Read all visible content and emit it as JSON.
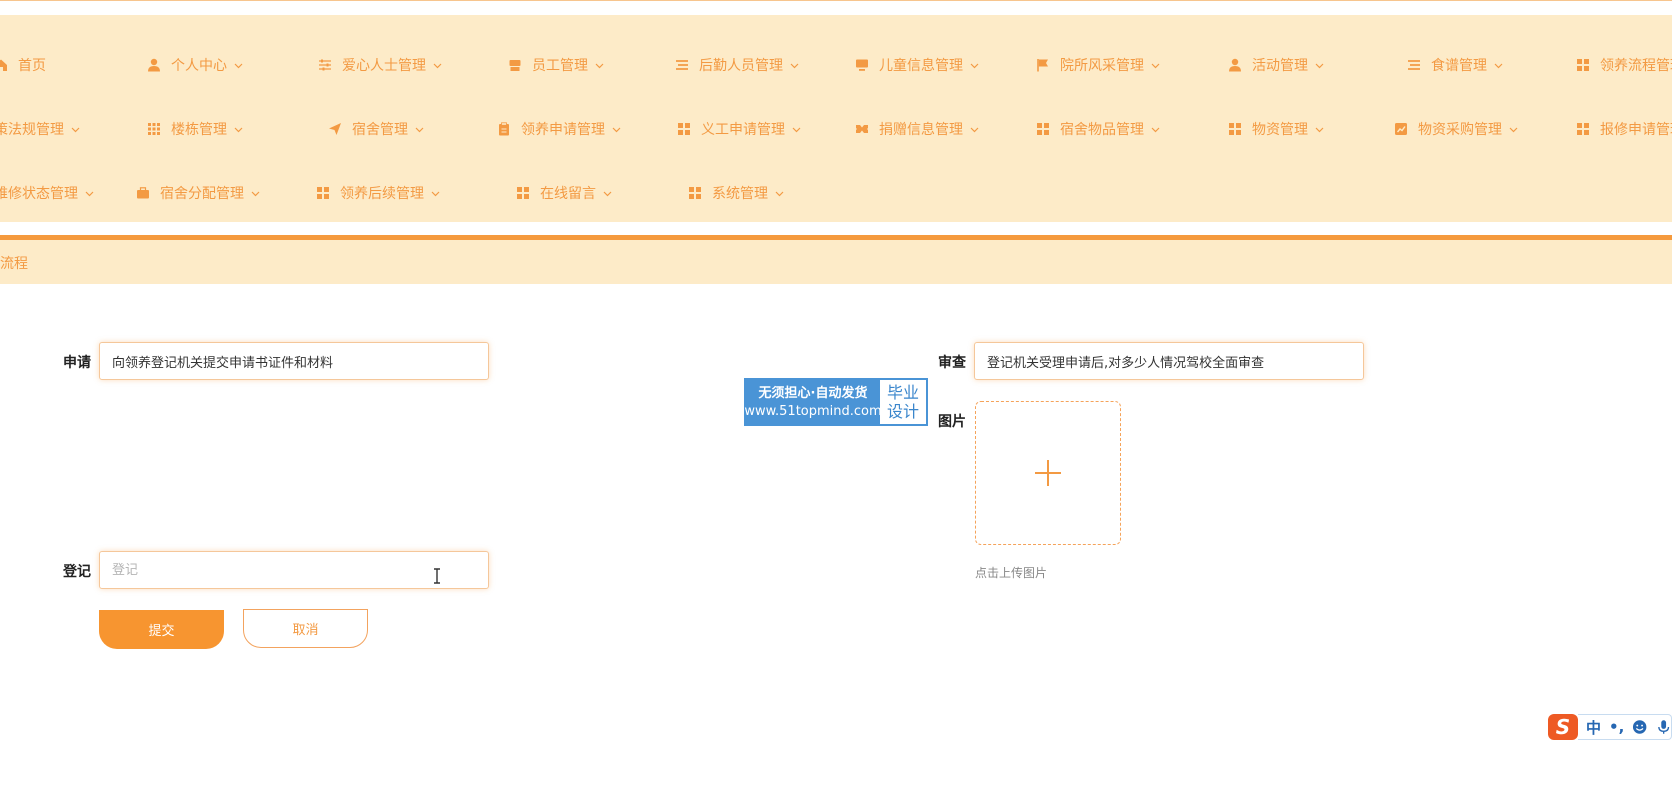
{
  "nav": {
    "row1": [
      {
        "label": "首页",
        "icon": "home-icon"
      },
      {
        "label": "个人中心",
        "icon": "user-icon"
      },
      {
        "label": "爱心人士管理",
        "icon": "sliders-icon"
      },
      {
        "label": "员工管理",
        "icon": "shop-icon"
      },
      {
        "label": "后勤人员管理",
        "icon": "list-icon"
      },
      {
        "label": "儿童信息管理",
        "icon": "monitor-icon"
      },
      {
        "label": "院所风采管理",
        "icon": "flag-icon"
      },
      {
        "label": "活动管理",
        "icon": "user-icon"
      },
      {
        "label": "食谱管理",
        "icon": "list-icon"
      },
      {
        "label": "领养流程管理",
        "icon": "grid-icon"
      }
    ],
    "row2": [
      {
        "label": "政策法规管理",
        "icon": "grid-icon"
      },
      {
        "label": "楼栋管理",
        "icon": "apps-icon"
      },
      {
        "label": "宿舍管理",
        "icon": "send-icon"
      },
      {
        "label": "领养申请管理",
        "icon": "clipboard-icon"
      },
      {
        "label": "义工申请管理",
        "icon": "grid-icon"
      },
      {
        "label": "捐赠信息管理",
        "icon": "ticket-icon"
      },
      {
        "label": "宿舍物品管理",
        "icon": "grid-icon"
      },
      {
        "label": "物资管理",
        "icon": "grid-icon"
      },
      {
        "label": "物资采购管理",
        "icon": "chart-icon"
      },
      {
        "label": "报修申请管理",
        "icon": "grid-icon"
      }
    ],
    "row3": [
      {
        "label": "维修状态管理",
        "icon": "grid-icon"
      },
      {
        "label": "宿舍分配管理",
        "icon": "briefcase-icon"
      },
      {
        "label": "领养后续管理",
        "icon": "grid-icon"
      },
      {
        "label": "在线留言",
        "icon": "grid-icon"
      },
      {
        "label": "系统管理",
        "icon": "grid-icon"
      }
    ]
  },
  "breadcrumb": {
    "text": "领养流程"
  },
  "form": {
    "apply_label": "申请",
    "apply_value": "向领养登记机关提交申请书证件和材料",
    "review_label": "审查",
    "review_value": "登记机关受理申请后,对多少人情况驾校全面审查",
    "image_label": "图片",
    "upload_hint": "点击上传图片",
    "register_label": "登记",
    "register_placeholder": "登记",
    "register_value": "",
    "submit_label": "提交",
    "cancel_label": "取消"
  },
  "watermark": {
    "line1": "无须担心·自动发货",
    "line2": "www.51topmind.com",
    "right1": "毕业",
    "right2": "设计"
  },
  "ime": {
    "logo": "S",
    "mode": "中",
    "punct": "•,"
  },
  "colors": {
    "accent": "#f79530",
    "nav_bg": "#fdebc8",
    "nav_text": "#f39a43",
    "watermark_blue": "#4a94d6"
  }
}
